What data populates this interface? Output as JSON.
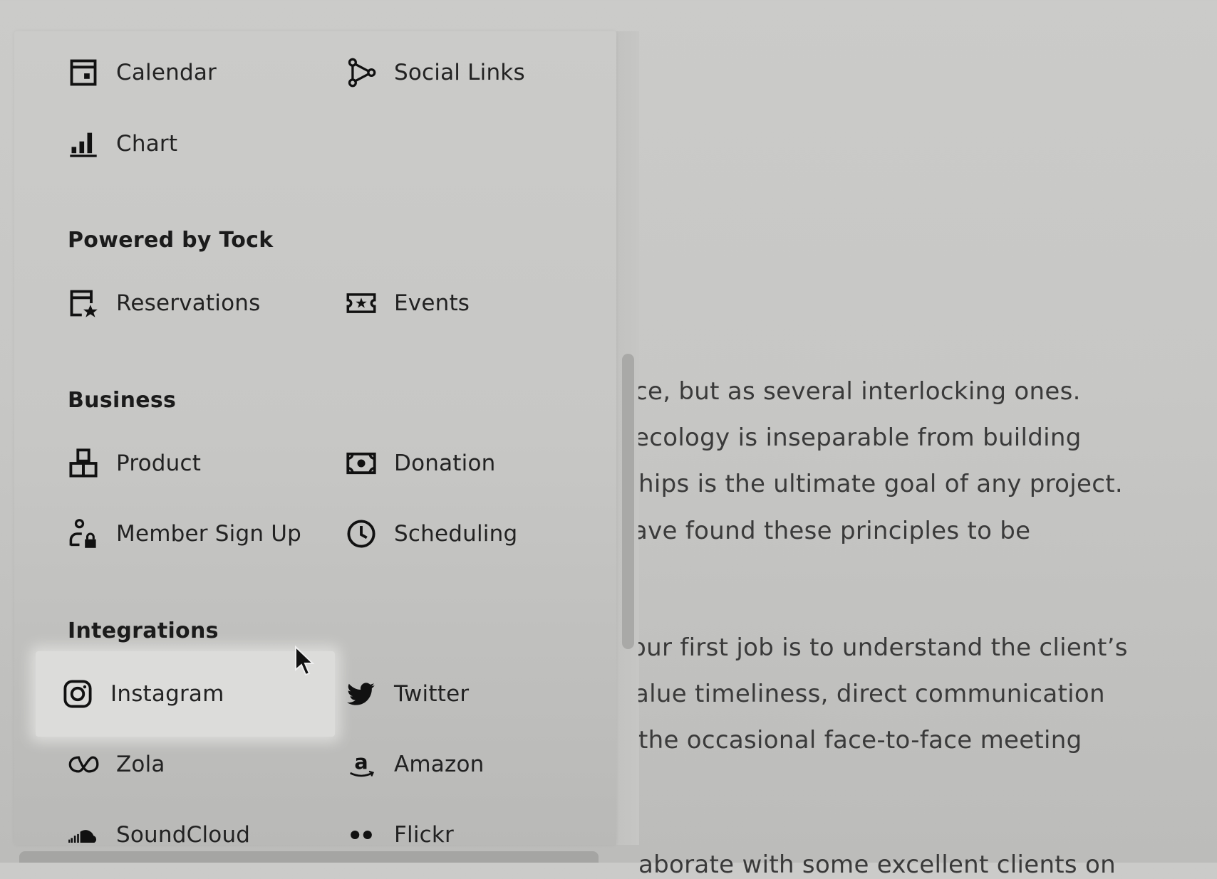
{
  "menu": {
    "top_items": [
      {
        "label": "Calendar",
        "icon": "calendar-icon"
      },
      {
        "label": "Social Links",
        "icon": "social-links-icon"
      },
      {
        "label": "Chart",
        "icon": "chart-icon"
      }
    ],
    "sections": [
      {
        "title": "Powered by Tock",
        "items": [
          {
            "label": "Reservations",
            "icon": "reservations-icon"
          },
          {
            "label": "Events",
            "icon": "ticket-icon"
          }
        ]
      },
      {
        "title": "Business",
        "items": [
          {
            "label": "Product",
            "icon": "product-icon"
          },
          {
            "label": "Donation",
            "icon": "donation-icon"
          },
          {
            "label": "Member Sign Up",
            "icon": "member-lock-icon"
          },
          {
            "label": "Scheduling",
            "icon": "clock-icon"
          }
        ]
      },
      {
        "title": "Integrations",
        "items": [
          {
            "label": "Instagram",
            "icon": "instagram-icon",
            "highlighted": true
          },
          {
            "label": "Twitter",
            "icon": "twitter-icon"
          },
          {
            "label": "Zola",
            "icon": "zola-icon"
          },
          {
            "label": "Amazon",
            "icon": "amazon-icon"
          },
          {
            "label": "SoundCloud",
            "icon": "soundcloud-icon"
          },
          {
            "label": "Flickr",
            "icon": "flickr-icon"
          }
        ]
      }
    ]
  },
  "background_text": {
    "paragraph1": [
      "ce, but as several interlocking ones.",
      "ecology is inseparable from building",
      "hips is the ultimate goal of any project.",
      "ave found these principles to be"
    ],
    "paragraph2": [
      "our first job is to understand the client’s",
      "alue timeliness, direct communication",
      "the occasional face-to-face meeting"
    ],
    "paragraph3_partial": "aborate with some excellent clients on"
  },
  "colors": {
    "background": "#c9c9c7",
    "highlight": "#dcdcda",
    "text": "#222222"
  }
}
